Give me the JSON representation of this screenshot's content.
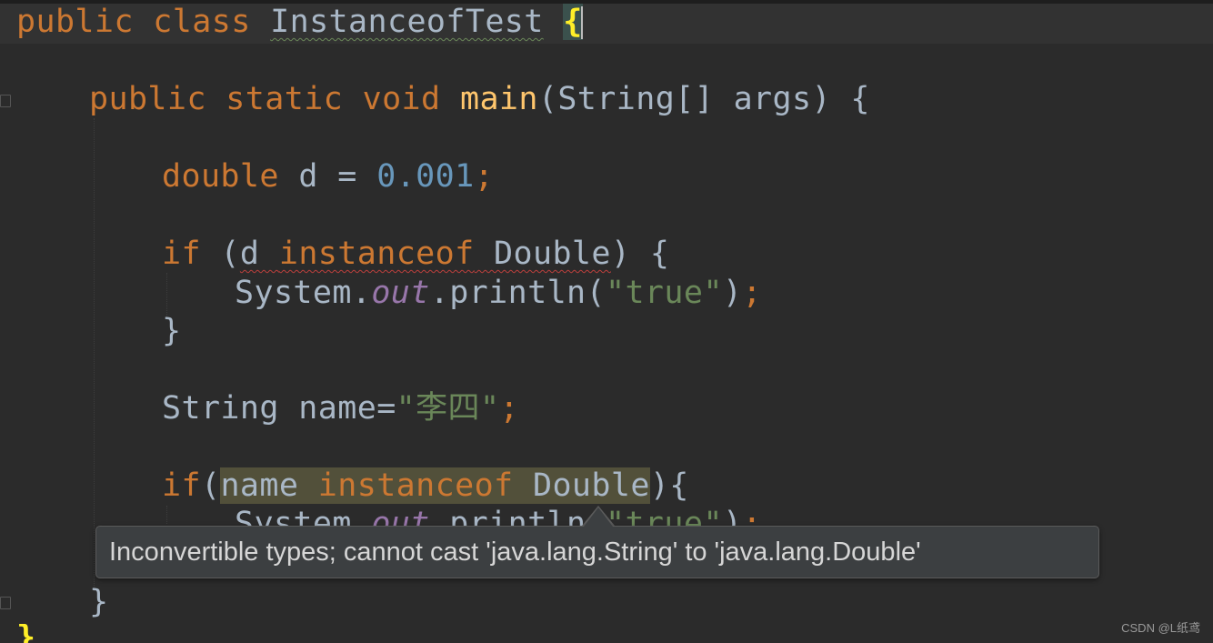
{
  "editor": {
    "lines": {
      "l1": {
        "kw": "public class ",
        "name": "InstanceofTest",
        "sp": " ",
        "brace": "{"
      },
      "l2": {
        "kw": "public static void ",
        "fn": "main",
        "rest": "(String[] args) {"
      },
      "l3": {
        "kw": "double ",
        "mid": "d = ",
        "num": "0.001",
        "semi": ";"
      },
      "l4": {
        "kw": "if",
        "a": " (",
        "err1": "d ",
        "err2": "instanceof",
        "err3": " Double",
        "b": ") {"
      },
      "l5": {
        "a": "System.",
        "field": "out",
        "b": ".println(",
        "str": "\"true\"",
        "c": ")",
        "semi": ";"
      },
      "l6": {
        "text": "}"
      },
      "l7": {
        "a": "String name=",
        "str": "\"李四\"",
        "semi": ";"
      },
      "l8": {
        "kw": "if",
        "a": "(",
        "h1": "name ",
        "h2": "instanceof",
        "h3": " Double",
        "b": "){"
      },
      "l9": {
        "a": "System.",
        "field": "out",
        "b": ".println(",
        "str": "\"true\"",
        "c": ")",
        "semi": ";"
      },
      "l10": {
        "text": "}"
      },
      "l11": {
        "text": "}"
      }
    },
    "theme": {
      "background": "#2b2b2b",
      "keyword": "#cc7832",
      "method": "#ffc66d",
      "number": "#6897bb",
      "string": "#6a8759",
      "field": "#9876aa",
      "text": "#a9b7c6"
    }
  },
  "tooltip": {
    "message": "Inconvertible types; cannot cast 'java.lang.String' to 'java.lang.Double'"
  },
  "watermark": "CSDN @L纸鸢"
}
